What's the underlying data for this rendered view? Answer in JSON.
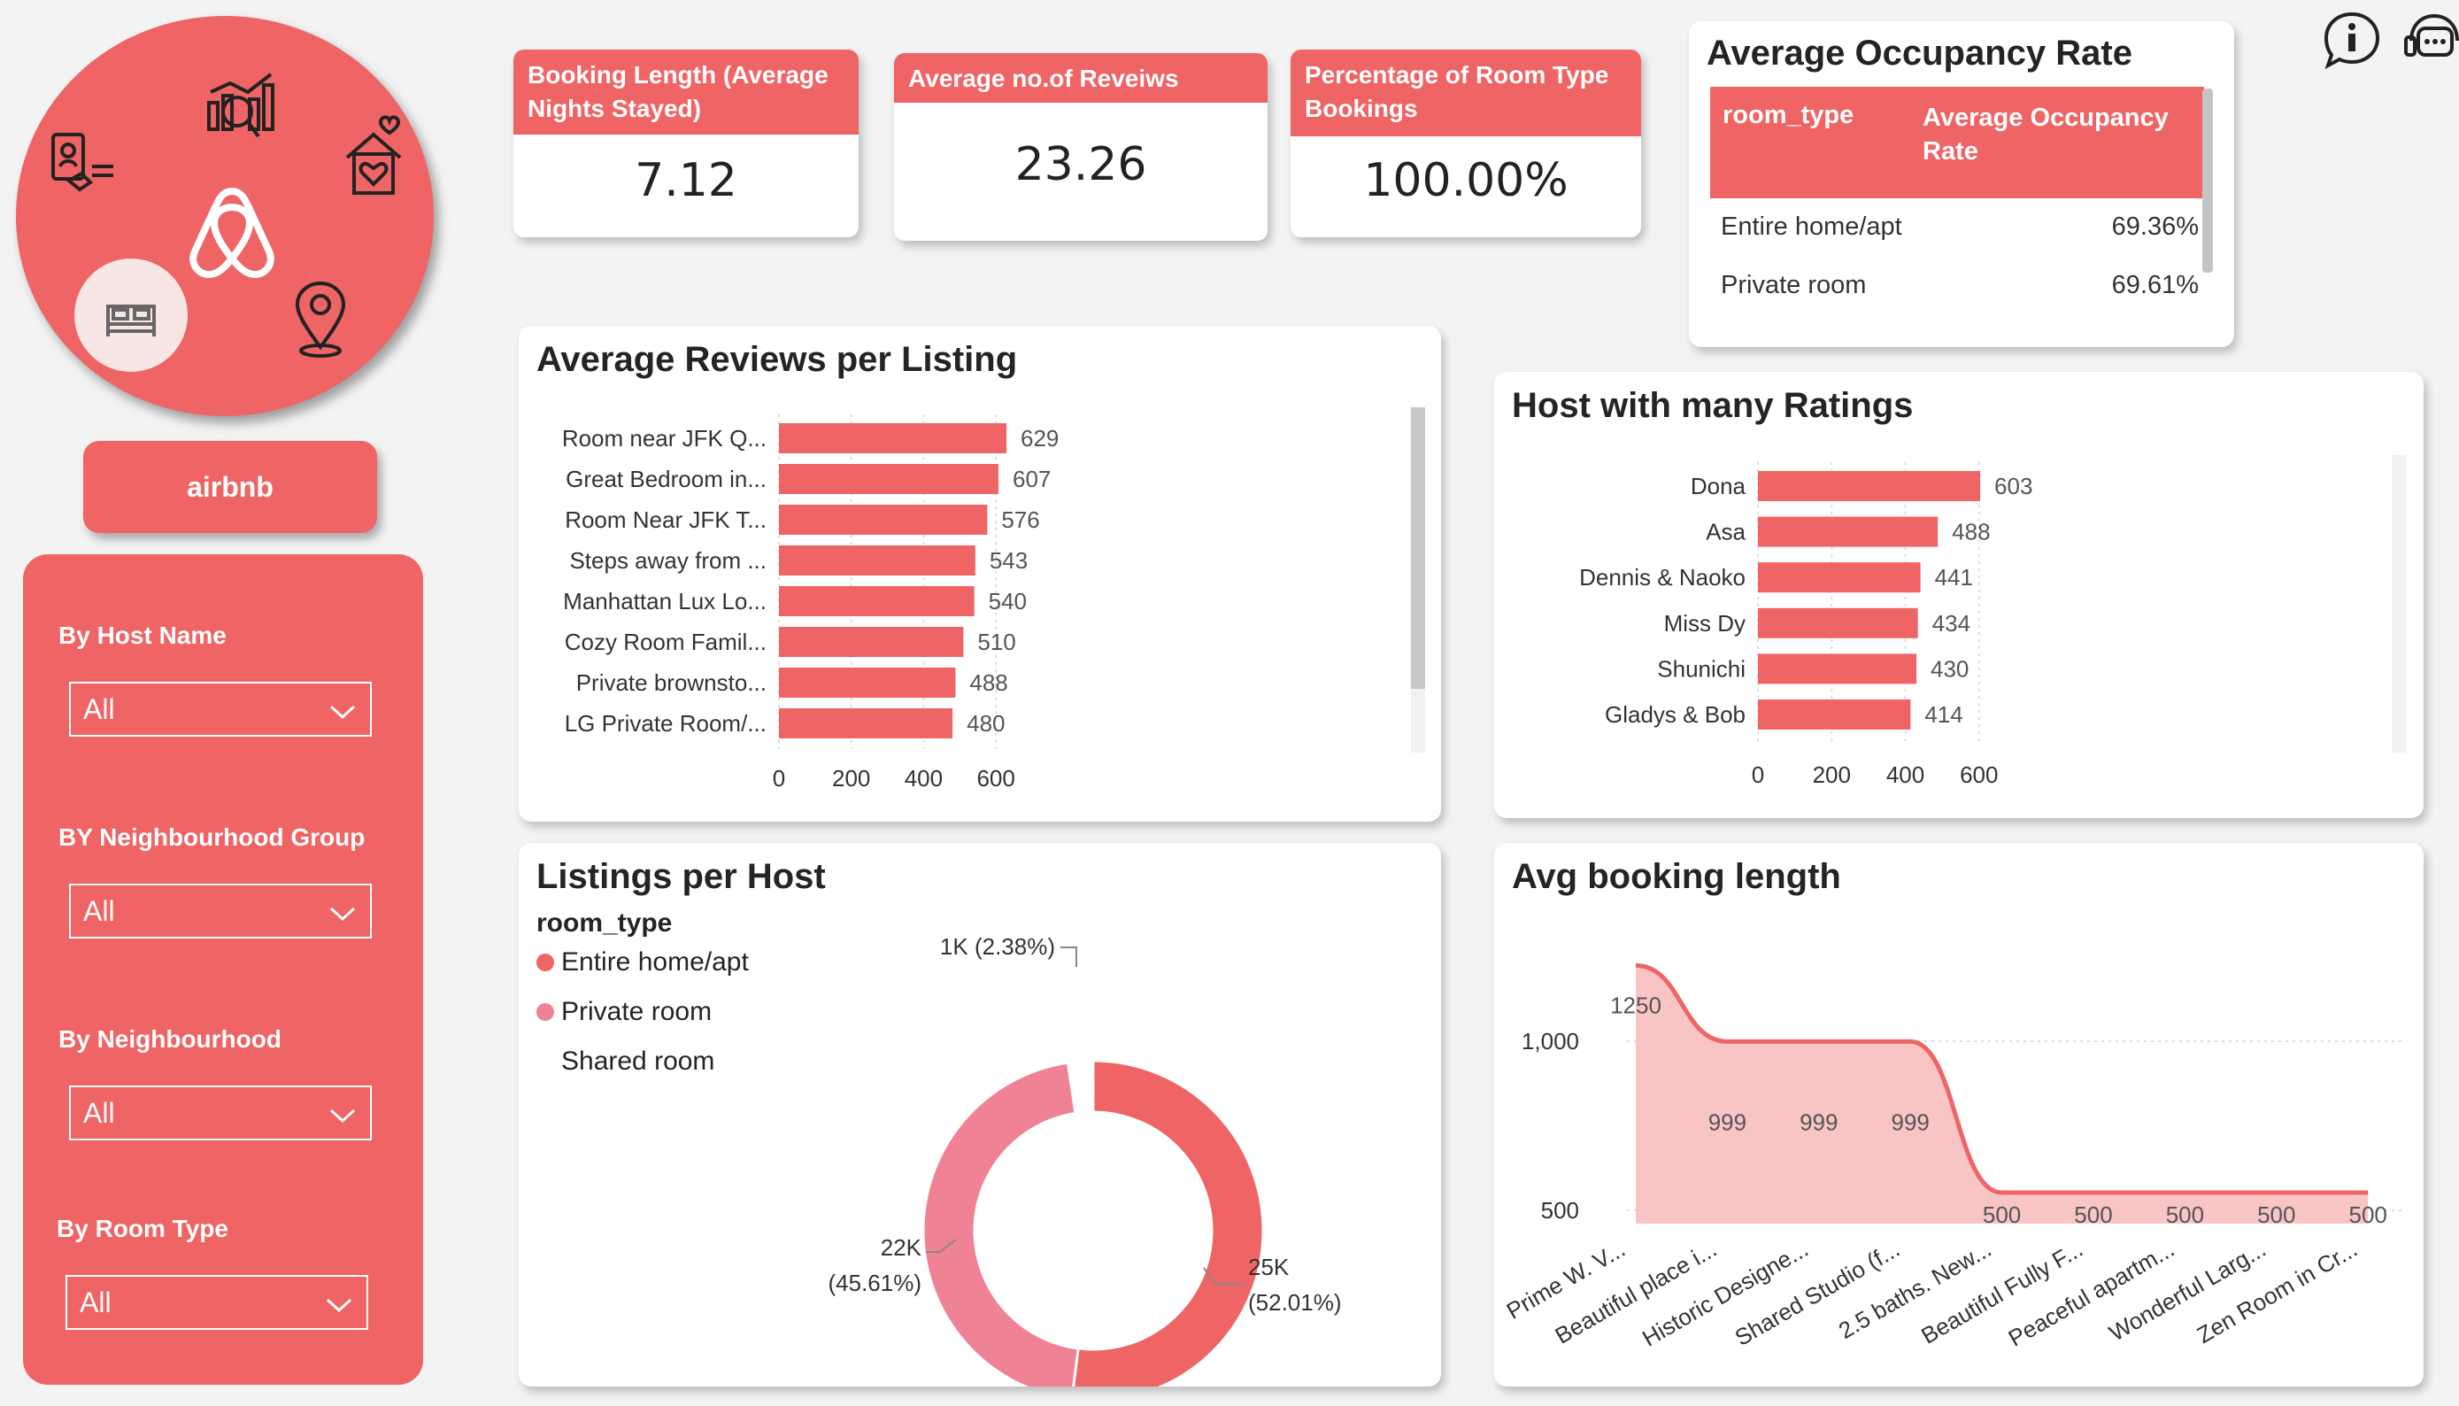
{
  "brand": {
    "button_label": "airbnb",
    "accent": "#ef6464",
    "pink": "#f08296",
    "icons": [
      "airbnb-logo-icon",
      "analytics-chart-icon",
      "house-heart-icon",
      "location-pin-icon",
      "bed-icon",
      "id-card-icon"
    ]
  },
  "filters": [
    {
      "label": "By Host Name",
      "value": "All"
    },
    {
      "label": "BY Neighbourhood Group",
      "value": "All"
    },
    {
      "label": "By Neighbourhood",
      "value": "All"
    },
    {
      "label": "By Room Type",
      "value": "All"
    }
  ],
  "kpis": {
    "booking_length": {
      "title": "Booking Length (Average Nights Stayed)",
      "value": "7.12"
    },
    "avg_reviews": {
      "title": "Average no.of Reveiws",
      "value": "23.26"
    },
    "pct_room_type": {
      "title": "Percentage of Room Type Bookings",
      "value": "100.00%"
    }
  },
  "occupancy": {
    "title": "Average Occupancy Rate",
    "col1": "room_type",
    "col2": "Average Occupancy Rate",
    "rows": [
      {
        "room_type": "Entire home/apt",
        "rate": "69.36%"
      },
      {
        "room_type": "Private room",
        "rate": "69.61%"
      }
    ]
  },
  "top_icons": [
    "info-chat-icon",
    "support-headset-icon"
  ],
  "chart_data": [
    {
      "id": "reviews",
      "type": "bar",
      "orientation": "horizontal",
      "title": "Average Reviews per Listing",
      "categories": [
        "Room near JFK Q...",
        "Great Bedroom in...",
        "Room Near JFK T...",
        "Steps away from ...",
        "Manhattan Lux Lo...",
        "Cozy Room Famil...",
        "Private brownsto...",
        "LG Private Room/..."
      ],
      "values": [
        629,
        607,
        576,
        543,
        540,
        510,
        488,
        480
      ],
      "xticks": [
        "0",
        "200",
        "400",
        "600"
      ],
      "xlim": [
        0,
        700
      ]
    },
    {
      "id": "hosts",
      "type": "bar",
      "orientation": "horizontal",
      "title": "Host with many Ratings",
      "categories": [
        "Dona",
        "Asa",
        "Dennis & Naoko",
        "Miss Dy",
        "Shunichi",
        "Gladys & Bob"
      ],
      "values": [
        603,
        488,
        441,
        434,
        430,
        414
      ],
      "xticks": [
        "0",
        "200",
        "400",
        "600"
      ],
      "xlim": [
        0,
        700
      ]
    },
    {
      "id": "listings",
      "type": "pie",
      "title": "Listings per Host",
      "legend_title": "room_type",
      "series": [
        {
          "name": "Entire home/apt",
          "value": 52.01,
          "label": "25K",
          "pct": "(52.01%)",
          "color": "#ef6464"
        },
        {
          "name": "Private room",
          "value": 45.61,
          "label": "22K",
          "pct": "(45.61%)",
          "color": "#f08296"
        },
        {
          "name": "Shared room",
          "value": 2.38,
          "label": "1K (2.38%)",
          "pct": "",
          "color": "#ffffff"
        }
      ]
    },
    {
      "id": "booking",
      "type": "area",
      "title": "Avg booking length",
      "categories": [
        "Prime W. V...",
        "Beautiful place i...",
        "Historic Designe...",
        "Shared Studio (f...",
        "2.5 baths. New...",
        "Beautiful Fully F...",
        "Peaceful apartm...",
        "Wonderful Larg...",
        "Zen Room in Cr..."
      ],
      "values": [
        1250,
        999,
        999,
        999,
        500,
        500,
        500,
        500,
        500
      ],
      "yticks": [
        "500",
        "1,000"
      ],
      "ylim": [
        400,
        1300
      ]
    }
  ]
}
